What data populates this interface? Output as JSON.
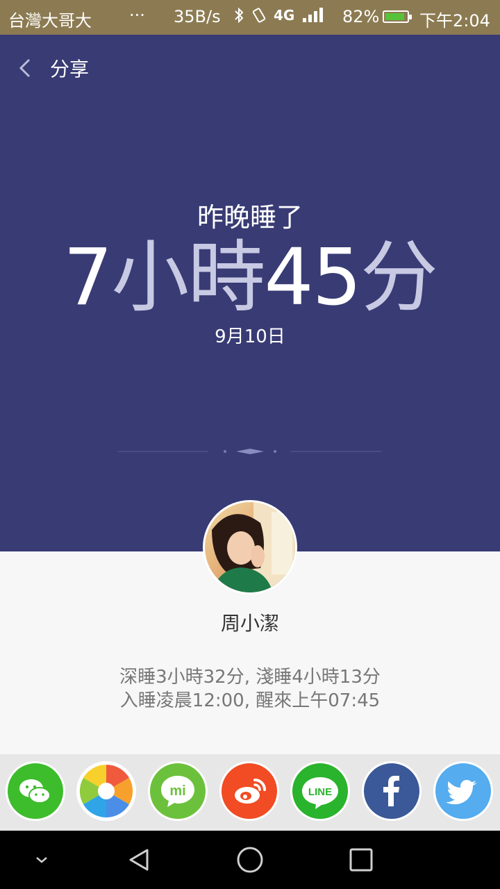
{
  "status_bar": {
    "carrier": "台灣大哥大",
    "more": "···",
    "speed": "35B/s",
    "network": "4G",
    "battery_percent": "82%",
    "time": "下午2:04"
  },
  "header": {
    "title": "分享",
    "subtitle": "昨晚睡了",
    "duration": {
      "hours": "7",
      "hours_unit": "小時",
      "minutes": "45",
      "minutes_unit": "分"
    },
    "date": "9月10日"
  },
  "profile": {
    "username": "周小潔",
    "stats_line1": "深睡3小時32分, 淺睡4小時13分",
    "stats_line2": "入睡凌晨12:00, 醒來上午07:45"
  },
  "share_targets": [
    {
      "name": "wechat",
      "color": "#3dbc2c"
    },
    {
      "name": "moments",
      "color": "#ffffff"
    },
    {
      "name": "mi-talk",
      "color": "#6cc13c"
    },
    {
      "name": "weibo",
      "color": "#f14c24"
    },
    {
      "name": "line",
      "color": "#2ab32c"
    },
    {
      "name": "facebook",
      "color": "#3b5998"
    },
    {
      "name": "twitter",
      "color": "#55acee"
    }
  ],
  "colors": {
    "header_bg": "#383b74",
    "status_bar_bg": "#8c7b52",
    "unit_text": "#c8c9e3"
  }
}
